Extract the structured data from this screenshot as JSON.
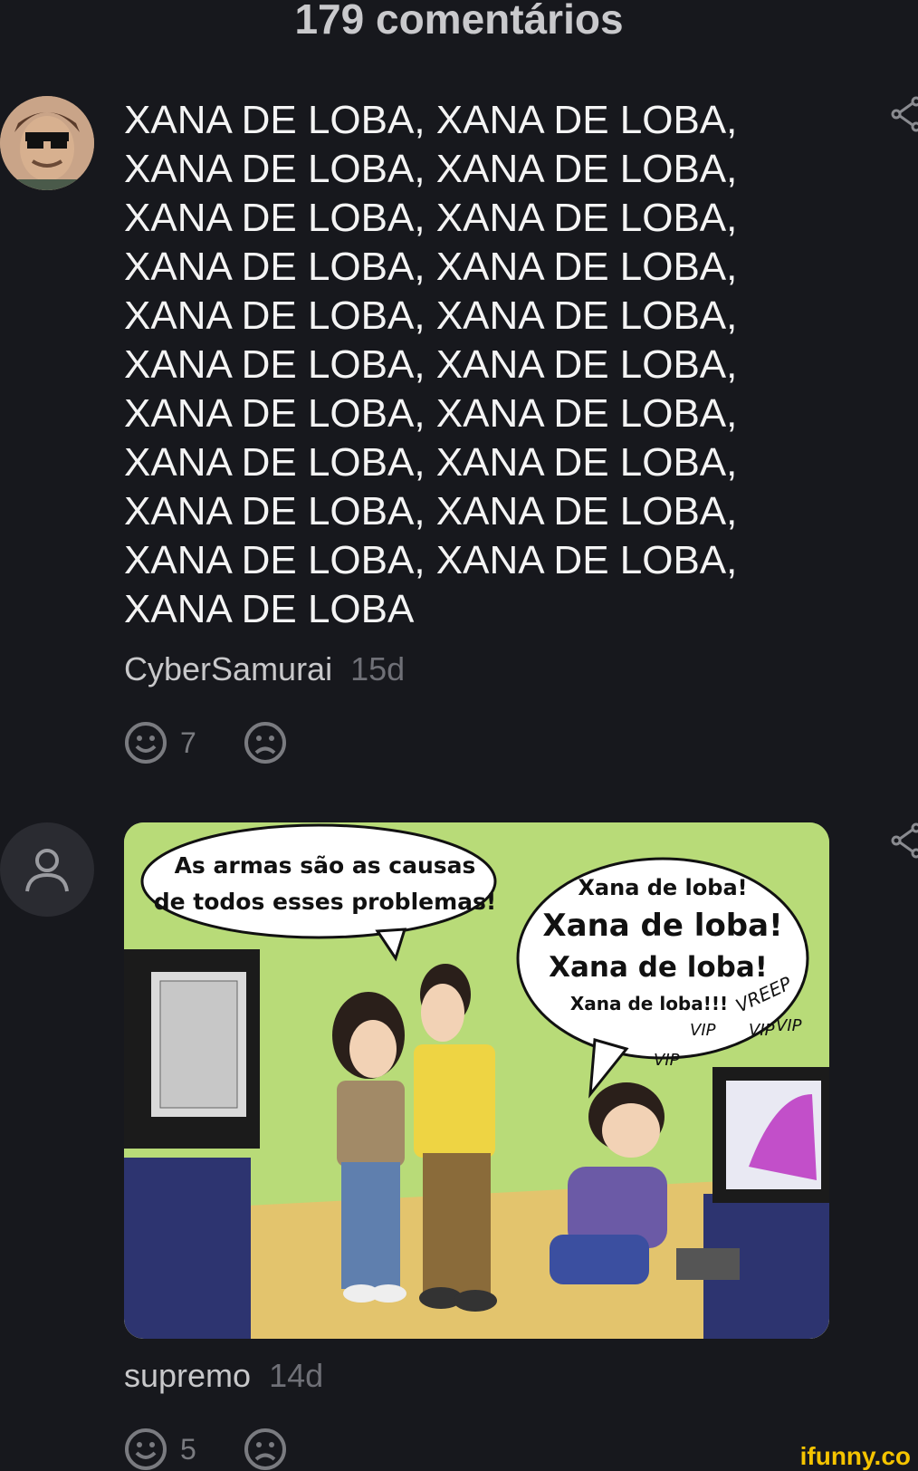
{
  "header": {
    "title": "179 comentários"
  },
  "comments": [
    {
      "text": "XANA DE LOBA, XANA DE LOBA,\nXANA DE LOBA, XANA DE LOBA,\nXANA DE LOBA, XANA DE LOBA,\nXANA DE LOBA, XANA DE LOBA,\nXANA DE LOBA, XANA DE LOBA,\nXANA DE LOBA, XANA DE LOBA,\nXANA DE LOBA, XANA DE LOBA,\nXANA DE LOBA, XANA DE LOBA,\nXANA DE LOBA, XANA DE LOBA,\nXANA DE LOBA, XANA DE LOBA,\nXANA DE LOBA",
      "username": "CyberSamurai",
      "time": "15d",
      "likes": "7"
    },
    {
      "username": "supremo",
      "time": "14d",
      "likes": "5",
      "image": {
        "bubble_left": [
          "As armas são as causas",
          "de todos esses problemas!"
        ],
        "bubble_right": [
          "Xana de loba!",
          "Xana de loba!",
          "Xana de loba!",
          "Xana de loba!!!"
        ],
        "sfx": [
          "VREEP",
          "VIP",
          "VIP",
          "VIP",
          "VIP"
        ]
      }
    }
  ],
  "watermark": "ifunny.co",
  "colors": {
    "background": "#17181d",
    "watermark": "#f5c400"
  }
}
